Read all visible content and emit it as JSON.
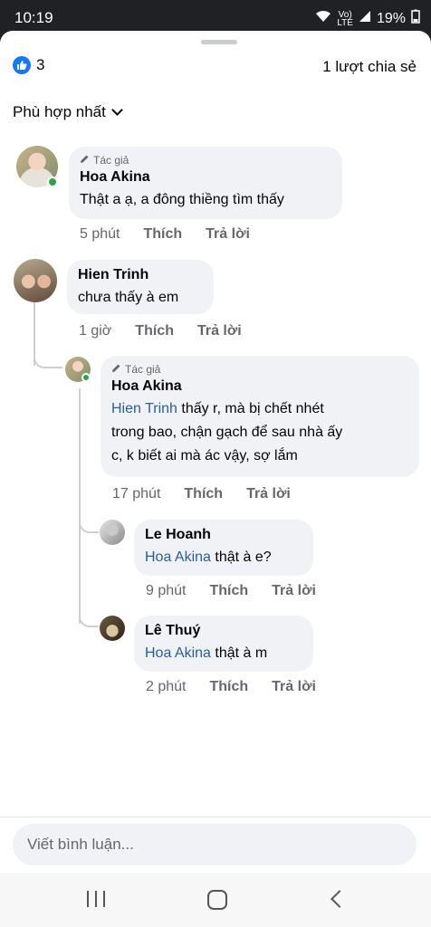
{
  "status_bar": {
    "time": "10:19",
    "battery": "19%"
  },
  "reactions": {
    "count": "3",
    "shares": "1 lượt chia sẻ"
  },
  "sort": {
    "label": "Phù hợp nhất"
  },
  "comments": [
    {
      "author_tag": "Tác giả",
      "name": "Hoa Akina",
      "text": "Thật a ạ, a đông thiềng tìm thấy",
      "time": "5 phút",
      "like": "Thích",
      "reply": "Trả lời"
    },
    {
      "name": "Hien Trinh",
      "text": "chưa thấy à em",
      "time": "1 giờ",
      "like": "Thích",
      "reply": "Trả lời"
    }
  ],
  "replies": [
    {
      "author_tag": "Tác giả",
      "name": "Hoa Akina",
      "mention": "Hien Trinh",
      "text_line1": " thấy r, mà bị chết nhét",
      "text_line2": "trong bao, chận gạch để sau nhà ấy",
      "text_line3": "c, k biết ai mà ác vậy, sợ lắm",
      "time": "17 phút",
      "like": "Thích",
      "reply": "Trả lời"
    },
    {
      "name": "Le Hoanh",
      "mention": "Hoa Akina",
      "text": " thật à e?",
      "time": "9 phút",
      "like": "Thích",
      "reply": "Trả lời"
    },
    {
      "name": "Lê Thuý",
      "mention": "Hoa Akina",
      "text": " thật à m",
      "time": "2 phút",
      "like": "Thích",
      "reply": "Trả lời"
    }
  ],
  "composer": {
    "placeholder": "Viết bình luận..."
  }
}
